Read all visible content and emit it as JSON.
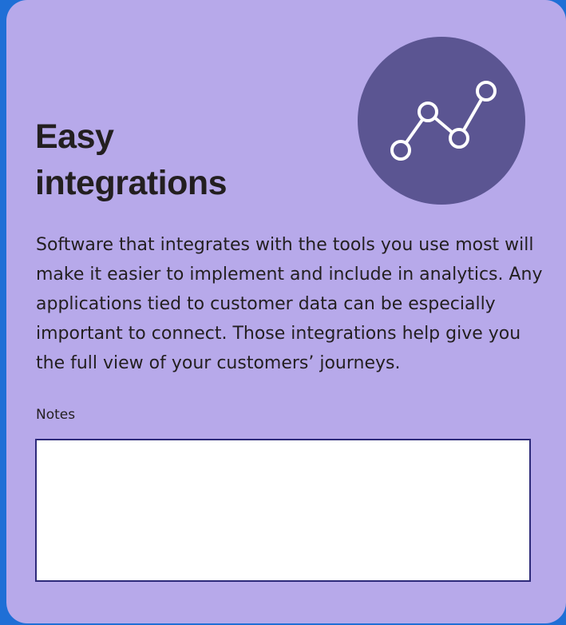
{
  "card": {
    "title": "Easy integrations",
    "description": "Software that integrates with the tools you use most will make it easier to implement and include in analytics. Any applications tied to customer data can be especially important to connect. Those integrations help give you the full view of your customers’ journeys.",
    "icon": "line-chart-icon"
  },
  "notes": {
    "label": "Notes",
    "value": ""
  },
  "colors": {
    "page_background": "#1f6fd6",
    "card_background": "#b7a9ea",
    "icon_circle": "#5b5592",
    "text": "#231f20",
    "notes_border": "#2d2a7a"
  }
}
